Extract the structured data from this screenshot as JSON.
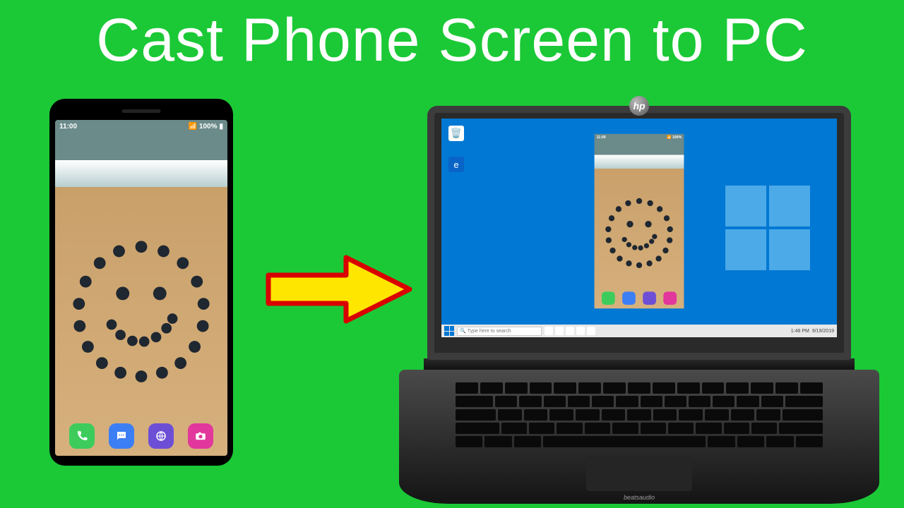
{
  "title": "Cast Phone Screen to PC",
  "phone": {
    "time": "11:00",
    "battery_text": "100%",
    "signal_text": "📶",
    "dock": [
      {
        "name": "phone-icon",
        "color": "green"
      },
      {
        "name": "messages-icon",
        "color": "blue"
      },
      {
        "name": "browser-icon",
        "color": "purple"
      },
      {
        "name": "camera-icon",
        "color": "pink"
      }
    ]
  },
  "laptop": {
    "brand": "hp",
    "audio_brand": "beatsaudio",
    "desktop_icons": [
      "recycle-bin-icon",
      "edge-icon"
    ],
    "taskbar": {
      "search_placeholder": "Type here to search",
      "time": "1:48 PM",
      "date": "9/19/2019"
    }
  }
}
